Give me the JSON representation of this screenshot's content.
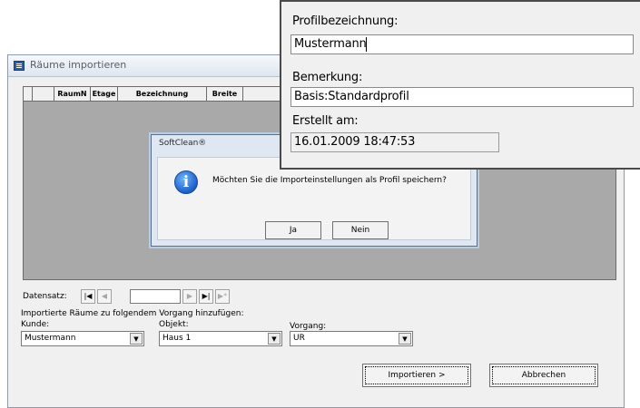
{
  "main_window": {
    "title": "Räume importieren",
    "grid": {
      "columns": [
        "",
        "",
        "RaumN",
        "Etage",
        "Bezeichnung",
        "Breite"
      ]
    },
    "nav": {
      "label": "Datensatz:",
      "first": "|◀",
      "prev": "◀",
      "next": "▶",
      "last": "▶|",
      "new": "▶*",
      "record_value": ""
    },
    "assign_label": "Importierte Räume zu folgendem Vorgang hinzufügen:",
    "kunde": {
      "label": "Kunde:",
      "value": "Mustermann"
    },
    "objekt": {
      "label": "Objekt:",
      "value": "Haus 1"
    },
    "vorgang": {
      "label": "Vorgang:",
      "value": "UR"
    },
    "import_button": "Importieren >",
    "cancel_button": "Abbrechen"
  },
  "dialog": {
    "title": "SoftClean®",
    "icon": "info-icon",
    "icon_glyph": "i",
    "message": "Möchten Sie die Importeinstellungen als Profil speichern?",
    "yes_button": "Ja",
    "no_button": "Nein"
  },
  "profile": {
    "name_label": "Profilbezeichnung:",
    "name_value": "Mustermann",
    "remark_label": "Bemerkung:",
    "remark_value": "Basis:Standardprofil",
    "created_label": "Erstellt am:",
    "created_value": "16.01.2009 18:47:53"
  },
  "colors": {
    "grid_background": "#a9a9a9",
    "window_background": "#f0f0f0",
    "info_icon": "#1b5fc6"
  }
}
